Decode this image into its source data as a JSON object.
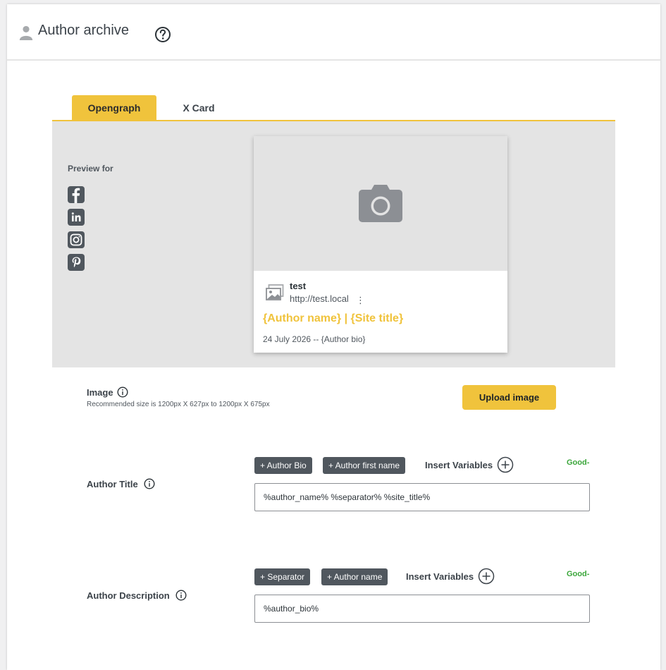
{
  "header": {
    "title": "Author archive",
    "user_icon": "user-icon",
    "help_icon": "question-circle-icon"
  },
  "tabs": [
    {
      "label": "Opengraph",
      "active": true
    },
    {
      "label": "X Card",
      "active": false
    }
  ],
  "preview": {
    "label": "Preview for",
    "networks": [
      "facebook-icon",
      "linkedin-icon",
      "instagram-icon",
      "pinterest-icon"
    ],
    "card": {
      "site_name": "test",
      "site_url": "http://test.local",
      "menu": "⋮",
      "title": "{Author name} | {Site title}",
      "description": "24 July 2026 -- {Author bio}"
    }
  },
  "image_field": {
    "label": "Image",
    "hint": "Recommended size is 1200px X 627px to 1200px X 675px",
    "upload_label": "Upload image"
  },
  "author_title": {
    "label": "Author Title",
    "chips": [
      "+ Author Bio",
      "+ Author first name"
    ],
    "insert_label": "Insert Variables",
    "status": "Good-",
    "value": "%author_name%  %separator%  %site_title%"
  },
  "author_description": {
    "label": "Author Description",
    "chips": [
      "+ Separator",
      "+ Author name"
    ],
    "insert_label": "Insert Variables",
    "status": "Good-",
    "value": "%author_bio%"
  },
  "colors": {
    "accent": "#f0c33c",
    "chip_bg": "#50575e",
    "status_good": "#3aa63a",
    "preview_bg": "#e4e4e4"
  }
}
